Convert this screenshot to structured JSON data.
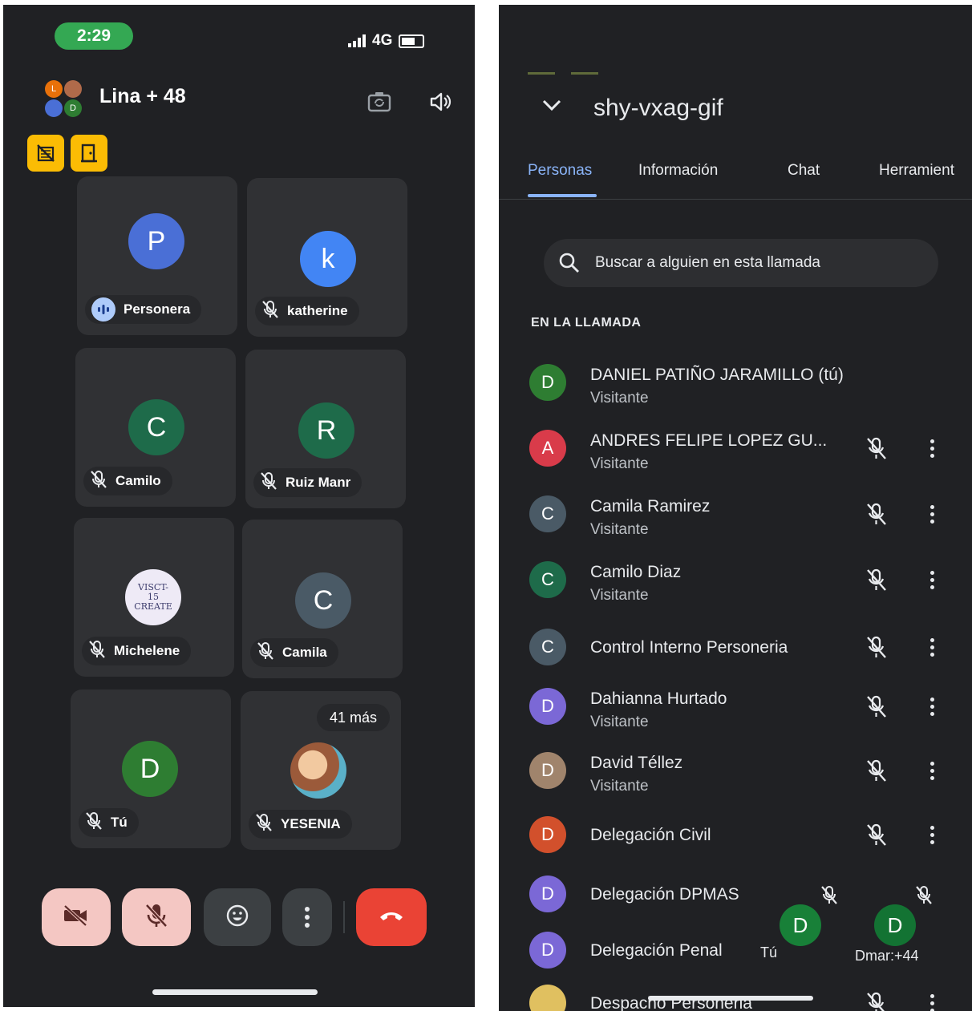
{
  "status_bar": {
    "time": "2:29",
    "network": "4G"
  },
  "call": {
    "title": "Lina + 48",
    "group_avatar_letters": [
      "L",
      "D"
    ]
  },
  "tiles": [
    {
      "name": "Personera",
      "initial": "P",
      "color": "#4a6fd6",
      "state": "speaking"
    },
    {
      "name": "katherine",
      "initial": "k",
      "color": "#4285f4",
      "state": "muted"
    },
    {
      "name": "Camilo",
      "initial": "C",
      "color": "#1e6b4a",
      "state": "muted"
    },
    {
      "name": "Ruiz Manr",
      "initial": "R",
      "color": "#1e6b4a",
      "state": "muted"
    },
    {
      "name": "Michelene",
      "initial": "",
      "color": "#e8e6f2",
      "state": "muted",
      "image_text": "VISCT-15 CREATE"
    },
    {
      "name": "Camila",
      "initial": "C",
      "color": "#4a5a66",
      "state": "muted"
    },
    {
      "name": "Tú",
      "initial": "D",
      "color": "#2e7d32",
      "state": "muted"
    },
    {
      "name": "YESENIA",
      "initial": "",
      "color": "#e0a8a8",
      "state": "muted",
      "badge": "41 más"
    }
  ],
  "controls": {
    "camera_off": "camera-off-icon",
    "mic_off": "mic-off-icon",
    "reactions": "emoji-icon",
    "more": "more-vert-icon",
    "end_call": "hang-up-icon"
  },
  "panel": {
    "meeting_code": "shy-vxag-gif",
    "tabs": [
      "Personas",
      "Información",
      "Chat",
      "Herramient"
    ],
    "active_tab": "Personas",
    "search_placeholder": "Buscar a alguien en esta llamada",
    "section_title": "EN LA LLAMADA",
    "participants": [
      {
        "name": "DANIEL PATIÑO JARAMILLO (tú)",
        "role": "Visitante",
        "initial": "D",
        "color": "#2e7d32",
        "controls": false
      },
      {
        "name": "ANDRES FELIPE LOPEZ GU...",
        "role": "Visitante",
        "initial": "A",
        "color": "#d93b4a",
        "controls": true
      },
      {
        "name": "Camila Ramirez",
        "role": "Visitante",
        "initial": "C",
        "color": "#4a5a66",
        "controls": true
      },
      {
        "name": "Camilo Diaz",
        "role": "Visitante",
        "initial": "C",
        "color": "#1e6b4a",
        "controls": true
      },
      {
        "name": "Control Interno Personeria",
        "role": "",
        "initial": "C",
        "color": "#4a5a66",
        "controls": true
      },
      {
        "name": "Dahianna Hurtado",
        "role": "Visitante",
        "initial": "D",
        "color": "#7b68d6",
        "controls": true
      },
      {
        "name": "David Téllez",
        "role": "Visitante",
        "initial": "D",
        "color": "#a0846c",
        "controls": true
      },
      {
        "name": "Delegación Civil",
        "role": "",
        "initial": "D",
        "color": "#d2502c",
        "controls": true
      },
      {
        "name": "Delegación DPMAS",
        "role": "",
        "initial": "D",
        "color": "#7b68d6",
        "controls": false
      },
      {
        "name": "Delegación Penal",
        "role": "",
        "initial": "D",
        "color": "#7b68d6",
        "controls": false
      },
      {
        "name": "Despacho Personeria",
        "role": "",
        "initial": "",
        "color": "#e0c060",
        "controls": true
      }
    ],
    "floating_tiles": [
      {
        "initial": "D",
        "label": "Tú"
      },
      {
        "initial": "D",
        "label": "Dmar:+44"
      }
    ]
  }
}
